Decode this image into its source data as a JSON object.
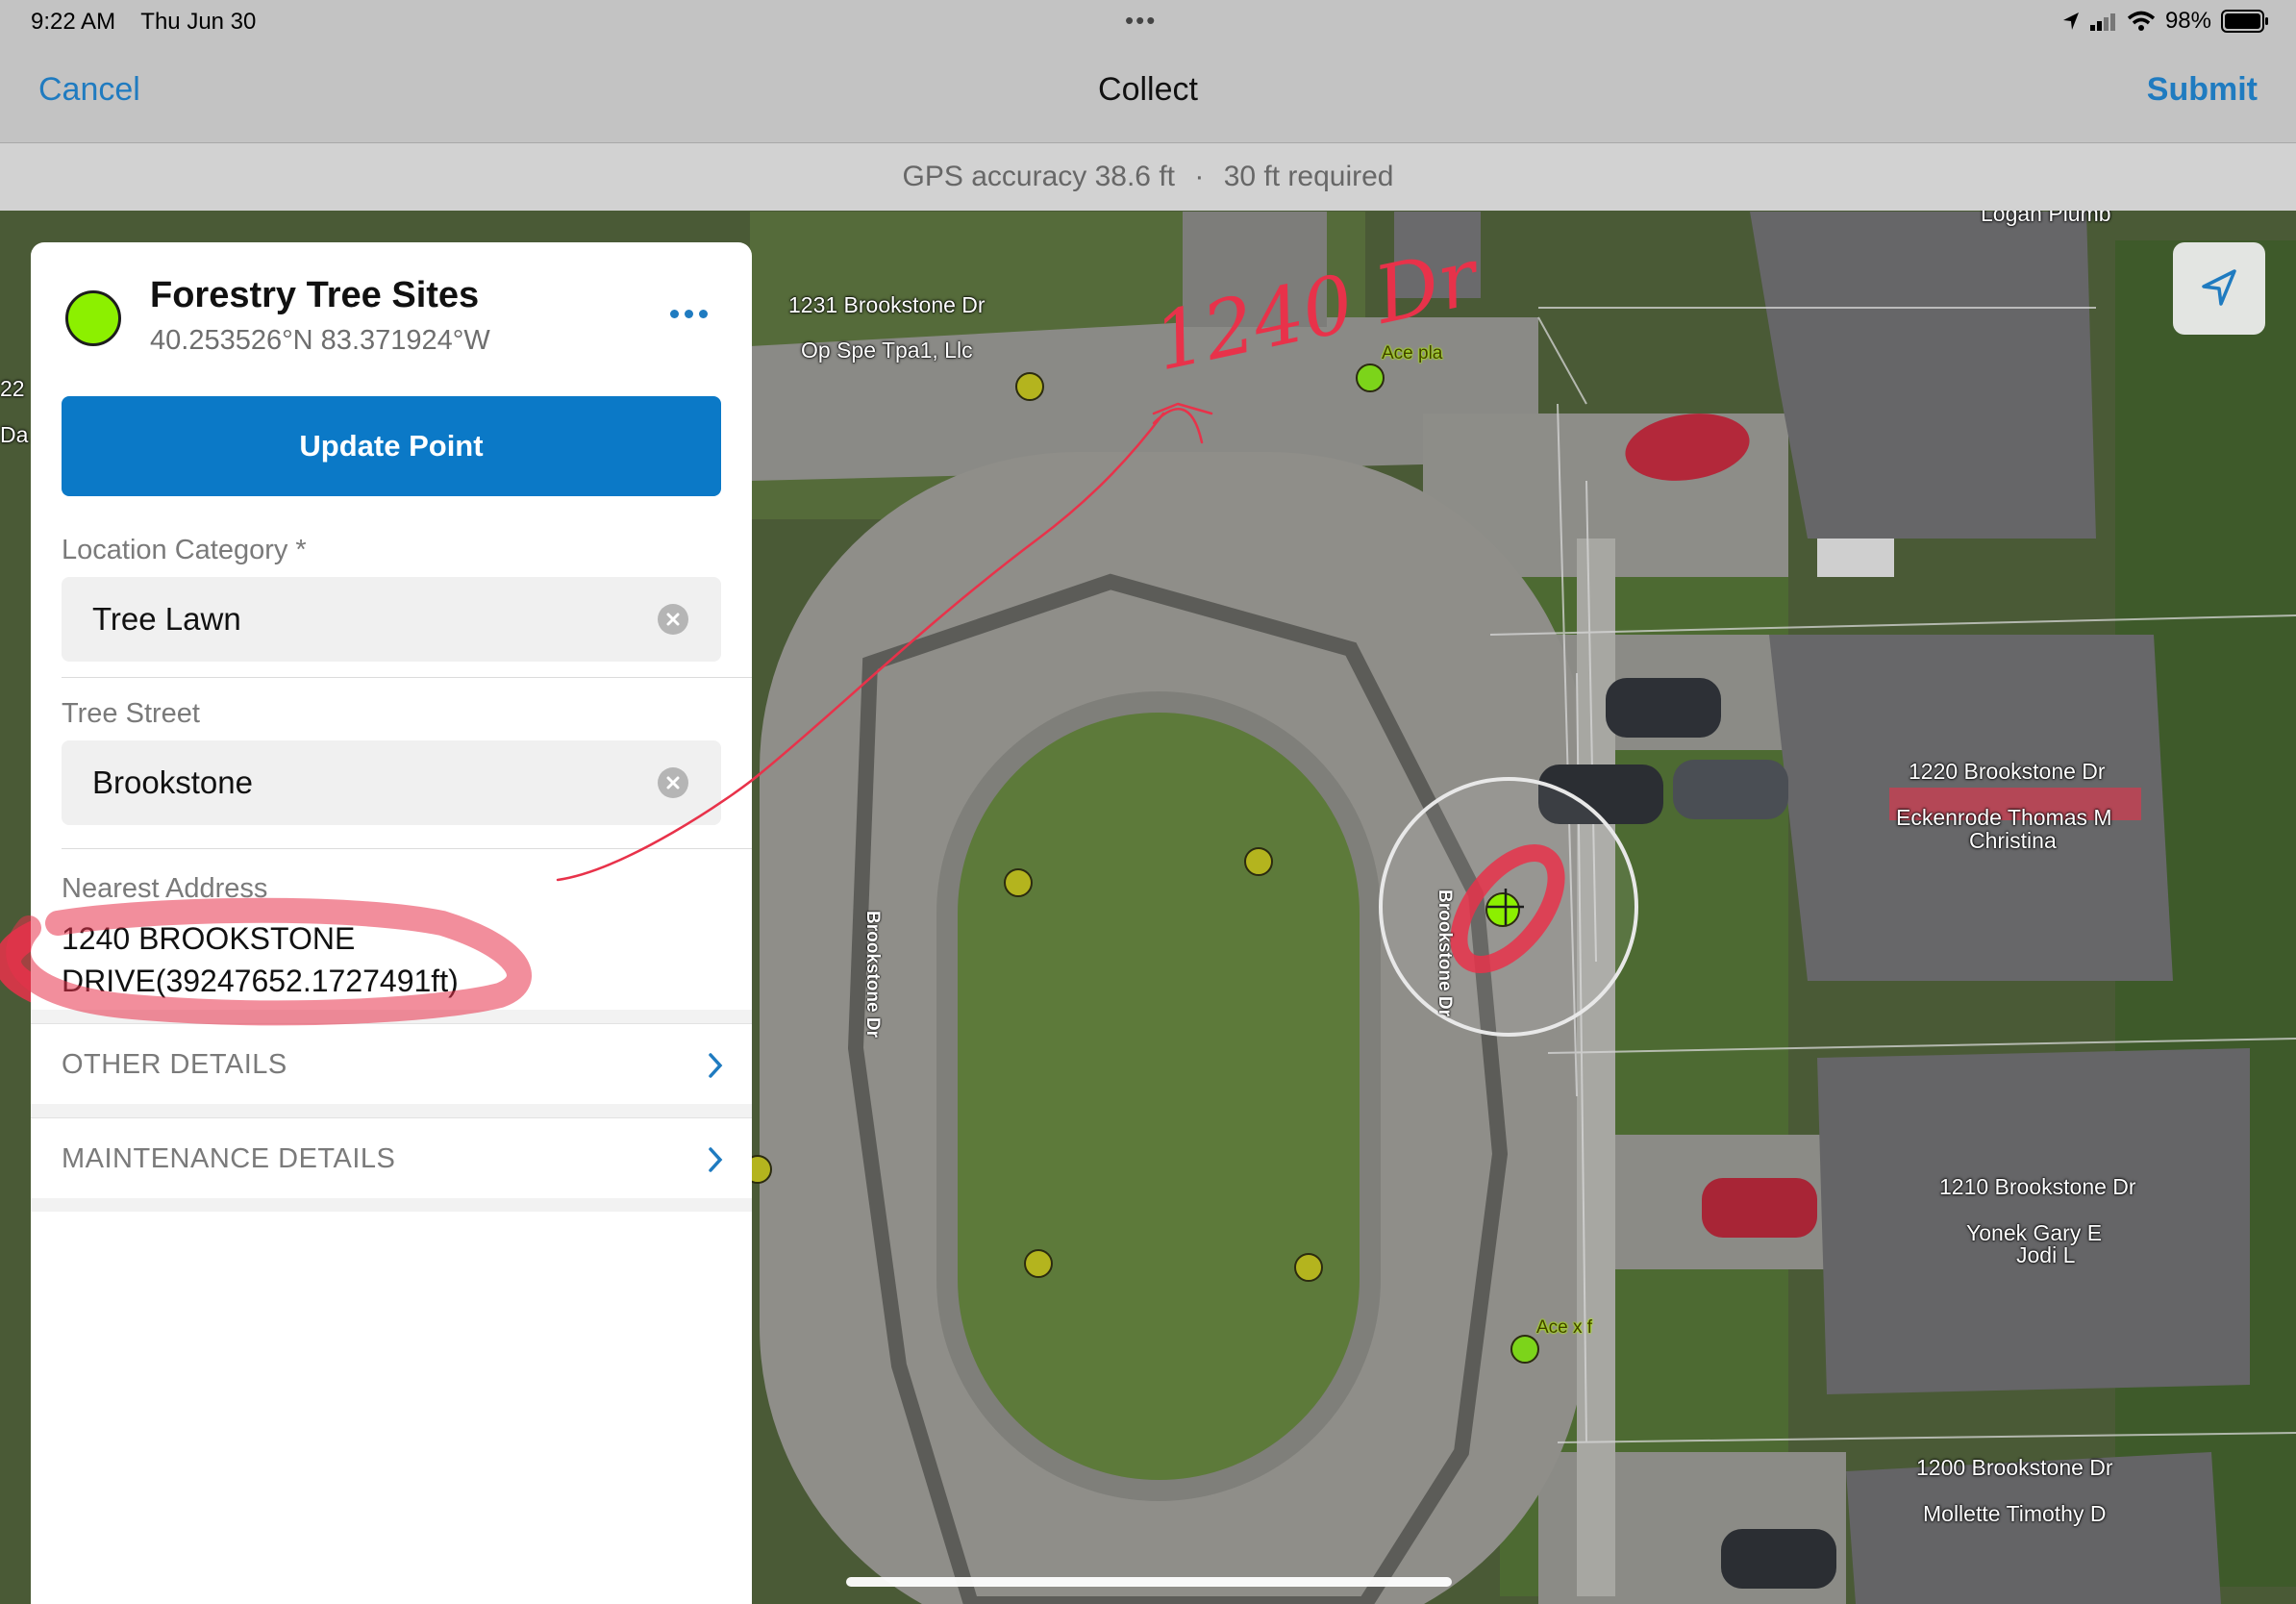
{
  "status_bar": {
    "time": "9:22 AM",
    "date": "Thu Jun 30",
    "battery": "98%"
  },
  "nav": {
    "cancel_label": "Cancel",
    "title": "Collect",
    "submit_label": "Submit"
  },
  "gps": {
    "accuracy_text": "GPS accuracy 38.6 ft",
    "separator": "·",
    "required_text": "30 ft required"
  },
  "feature": {
    "layer_name": "Forestry Tree Sites",
    "coordinates": "40.253526°N  83.371924°W",
    "swatch_color": "#8cf000",
    "more_icon": "more-horizontal-icon"
  },
  "form": {
    "update_button_label": "Update Point",
    "location_category_label": "Location Category *",
    "location_category_value": "Tree Lawn",
    "tree_street_label": "Tree Street",
    "tree_street_value": "Brookstone",
    "nearest_address_label": "Nearest Address",
    "nearest_address_line1": "1240 BROOKSTONE",
    "nearest_address_line2": "DRIVE(39247652.1727491ft)",
    "other_details_label": "OTHER DETAILS",
    "maintenance_details_label": "MAINTENANCE DETAILS"
  },
  "map": {
    "labels": {
      "logan": "Logan Plumb",
      "addr_1231": "1231 Brookstone Dr",
      "owner_1231": "Op Spe Tpa1, Llc",
      "addr_1220": "1220 Brookstone Dr",
      "owner_1220_a": "Eckenrode Thomas M",
      "owner_1220_b": "Christina",
      "addr_1210": "1210 Brookstone Dr",
      "owner_1210_a": "Yonek Gary E",
      "owner_1210_b": "Jodi L",
      "addr_1200": "1200 Brookstone Dr",
      "owner_1200": "Mollette Timothy D",
      "street_west": "Brookstone Dr",
      "street_east": "Brookstone Dr",
      "tree_top": "Ace pla",
      "tree_bottom": "Ace x f",
      "edge_a": "22",
      "edge_b": "Da"
    },
    "handwritten_note": "1240 Dr"
  },
  "colors": {
    "accent": "#1f7bc0",
    "primary_button": "#0b79c7",
    "tree_point": "#b4b41e",
    "selected_point": "#8cf000",
    "annotation": "#e8324a"
  }
}
